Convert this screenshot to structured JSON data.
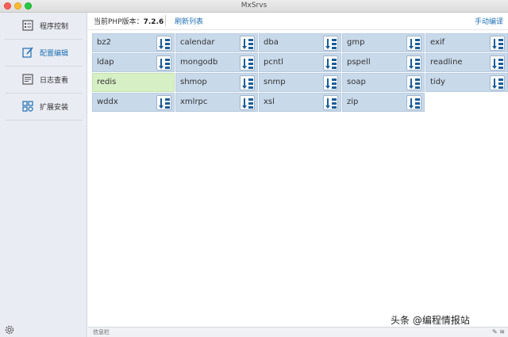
{
  "window": {
    "title": "MxSrvs"
  },
  "sidebar": {
    "items": [
      {
        "label": "程序控制",
        "icon": "list-icon",
        "active": false
      },
      {
        "label": "配置编辑",
        "icon": "edit-icon",
        "active": true
      },
      {
        "label": "日志查看",
        "icon": "log-icon",
        "active": false
      },
      {
        "label": "扩展安装",
        "icon": "extensions-icon",
        "active": false
      }
    ],
    "settings_icon": "gear-icon"
  },
  "toolbar": {
    "version_label": "当前PHP版本：",
    "version": "7.2.6",
    "refresh_label": "刷新列表",
    "manual_compile_label": "手动编译"
  },
  "extensions": [
    {
      "name": "bz2"
    },
    {
      "name": "calendar"
    },
    {
      "name": "dba"
    },
    {
      "name": "gmp"
    },
    {
      "name": "exif"
    },
    {
      "name": "ldap"
    },
    {
      "name": "mongodb"
    },
    {
      "name": "pcntl"
    },
    {
      "name": "pspell"
    },
    {
      "name": "readline"
    },
    {
      "name": "redis",
      "highlighted": true
    },
    {
      "name": "shmop"
    },
    {
      "name": "snmp"
    },
    {
      "name": "soap"
    },
    {
      "name": "tidy"
    },
    {
      "name": "wddx"
    },
    {
      "name": "xmlrpc"
    },
    {
      "name": "xsl"
    },
    {
      "name": "zip"
    }
  ],
  "statusbar": {
    "text": "信息栏"
  },
  "watermark": {
    "text": "头条 @编程情报站"
  },
  "colors": {
    "accent": "#1f6fb5",
    "cell": "#c8d9ea",
    "cell_highlight": "#d6efc4",
    "sidebar": "#e9ecf2"
  }
}
